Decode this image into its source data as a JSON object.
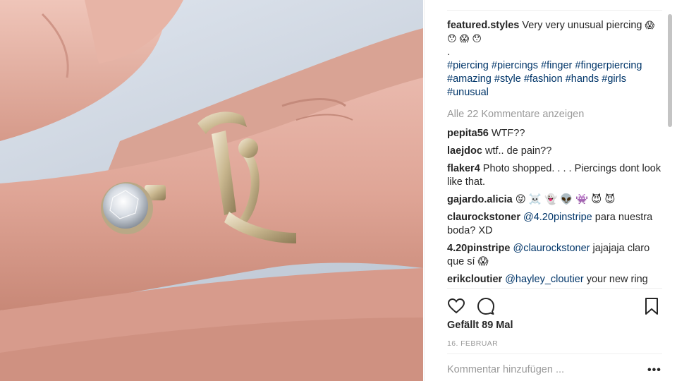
{
  "post": {
    "author": "featured.styles",
    "caption_text": "Very very unusual piercing",
    "caption_emojis": "😱 😯 😱 😯",
    "caption_dot": ".",
    "hashtags": [
      "#piercing",
      "#piercings",
      "#finger",
      "#fingerpiercing",
      "#amazing",
      "#style",
      "#fashion",
      "#hands",
      "#girls",
      "#unusual"
    ],
    "view_all_comments": "Alle 22 Kommentare anzeigen"
  },
  "comments": [
    {
      "user": "pepita56",
      "text": "WTF??"
    },
    {
      "user": "laejdoc",
      "text": "wtf.. de pain??"
    },
    {
      "user": "flaker4",
      "text": "Photo shopped. . . . Piercings dont look like that."
    },
    {
      "user": "gajardo.alicia",
      "text": "😝 ☠️ 👻 👽 👾 😈 😈"
    },
    {
      "user": "claurockstoner",
      "mention": "@4.20pinstripe",
      "text": "para nuestra boda? XD"
    },
    {
      "user": "4.20pinstripe",
      "mention": "@claurockstoner",
      "text": "jajajaja claro que sí 😱"
    },
    {
      "user": "erikcloutier",
      "mention": "@hayley_cloutier",
      "text": "your new ring"
    }
  ],
  "actions": {
    "like_icon": "heart-icon",
    "comment_icon": "comment-bubble-icon",
    "save_icon": "bookmark-icon"
  },
  "likes": "Gefällt 89 Mal",
  "date": "16. FEBRUAR",
  "comment_input": {
    "placeholder": "Kommentar hinzufügen ...",
    "value": ""
  },
  "more_label": "•••",
  "colors": {
    "link": "#003569",
    "muted": "#999999",
    "text": "#262626",
    "border": "#efefef"
  }
}
